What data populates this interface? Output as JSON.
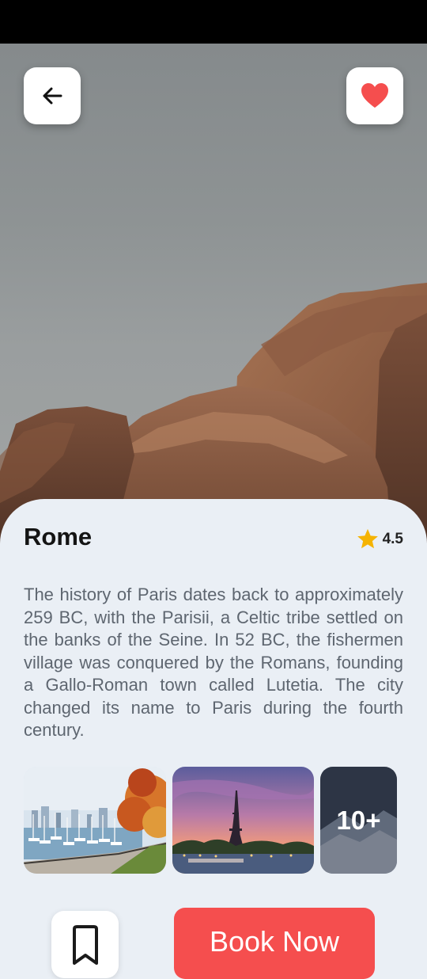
{
  "place": {
    "name": "Rome",
    "rating": "4.5",
    "description": "The history of Paris dates back to approximately 259 BC, with the Parisii, a Celtic tribe settled on the banks of the Seine. In 52 BC, the fishermen village was conquered by the Romans, founding a Gallo-Roman town called Lutetia. The city changed its name to Paris during the fourth century."
  },
  "gallery": {
    "more_label": "10+"
  },
  "actions": {
    "book_label": "Book Now"
  },
  "icons": {
    "back": "arrow-left-icon",
    "favorite": "heart-icon",
    "rating": "star-icon",
    "bookmark": "bookmark-icon"
  },
  "colors": {
    "accent": "#f54e4e",
    "star": "#f5b301",
    "background": "#eaeff5"
  }
}
